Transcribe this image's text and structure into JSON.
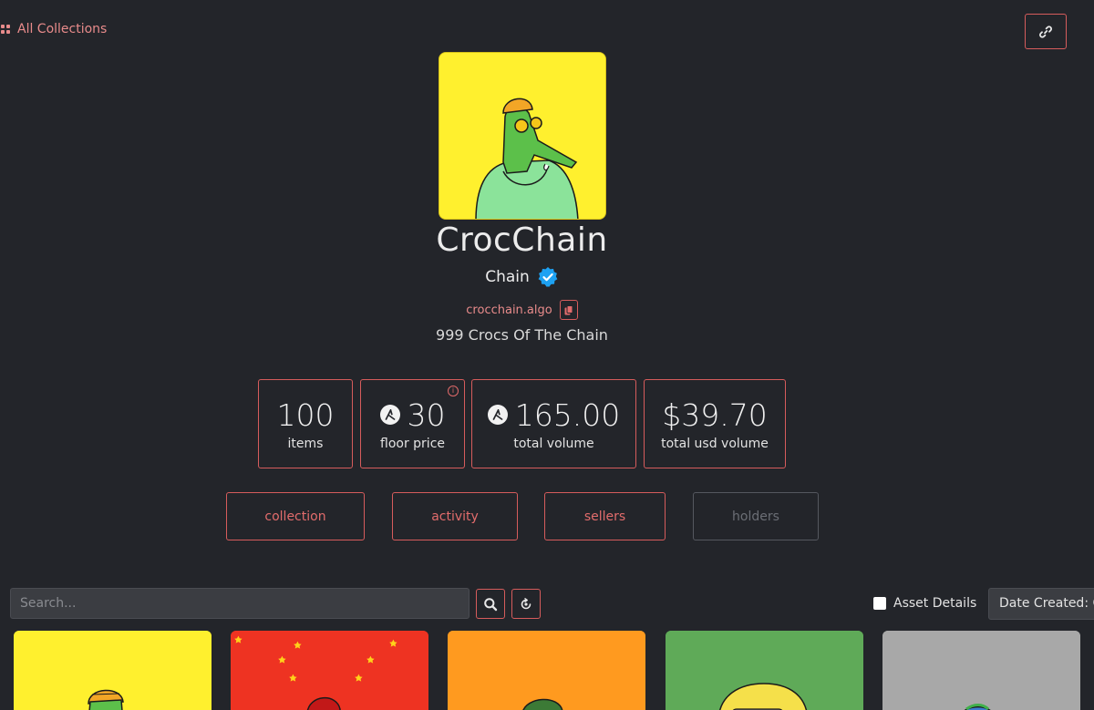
{
  "nav": {
    "all_collections": "All Collections"
  },
  "collection": {
    "name": "CrocChain",
    "creator": "Chain",
    "address": "crocchain.algo",
    "description": "999 Crocs Of The Chain"
  },
  "stats": [
    {
      "value": "100",
      "label": "items"
    },
    {
      "value": "30",
      "label": "floor price"
    },
    {
      "value": "165.00",
      "label": "total volume"
    },
    {
      "value": "$39.70",
      "label": "total usd volume"
    }
  ],
  "tabs": [
    {
      "label": "collection"
    },
    {
      "label": "activity"
    },
    {
      "label": "sellers"
    },
    {
      "label": "holders"
    }
  ],
  "toolbar": {
    "search_placeholder": "Search...",
    "asset_details_label": "Asset Details",
    "sort_value": "Date Created: C"
  },
  "colors": {
    "accent": "#d65c5c",
    "background": "#23252a",
    "verified": "#1da1f2",
    "card_backgrounds": [
      "#fff02e",
      "#ee3322",
      "#ff9a1f",
      "#5faa58",
      "#a8a8a8"
    ]
  },
  "icons": [
    "grid-icon",
    "link-icon",
    "verified-icon",
    "copy-icon",
    "algo-icon",
    "info-icon",
    "search-icon",
    "refresh-icon"
  ]
}
